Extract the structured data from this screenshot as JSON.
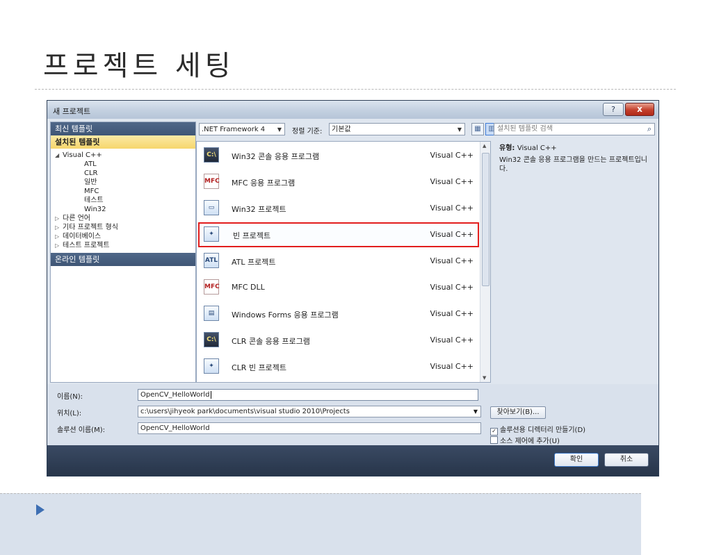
{
  "slide": {
    "title": "프로젝트 세팅"
  },
  "dialog": {
    "title": "새 프로젝트",
    "help_label": "?",
    "close_label": "x"
  },
  "left": {
    "recent_templates": "최신 템플릿",
    "installed_templates": "설치된 템플릿",
    "online_templates": "온라인 템플릿",
    "tree": [
      {
        "label": "Visual C++",
        "arrow": "◢"
      },
      {
        "label": "ATL"
      },
      {
        "label": "CLR"
      },
      {
        "label": "일반"
      },
      {
        "label": "MFC"
      },
      {
        "label": "테스트"
      },
      {
        "label": "Win32"
      },
      {
        "label": "다른 언어",
        "arrow": "▷"
      },
      {
        "label": "기타 프로젝트 형식",
        "arrow": "▷"
      },
      {
        "label": "데이터베이스",
        "arrow": "▷"
      },
      {
        "label": "테스트 프로젝트",
        "arrow": "▷"
      }
    ]
  },
  "toolbar": {
    "framework": ".NET Framework 4",
    "sort_label": "정렬 기준:",
    "sort_value": "기본값"
  },
  "templates": [
    {
      "name": "Win32 콘솔 응용 프로그램",
      "lang": "Visual C++",
      "icon": "console-app-icon",
      "glyph": "C:\\"
    },
    {
      "name": "MFC 응용 프로그램",
      "lang": "Visual C++",
      "icon": "mfc-app-icon",
      "glyph": "MFC"
    },
    {
      "name": "Win32 프로젝트",
      "lang": "Visual C++",
      "icon": "win32-project-icon",
      "glyph": "▭"
    },
    {
      "name": "빈 프로젝트",
      "lang": "Visual C++",
      "icon": "empty-project-icon",
      "glyph": "✦"
    },
    {
      "name": "ATL 프로젝트",
      "lang": "Visual C++",
      "icon": "atl-project-icon",
      "glyph": "ATL"
    },
    {
      "name": "MFC DLL",
      "lang": "Visual C++",
      "icon": "mfc-dll-icon",
      "glyph": "MFC"
    },
    {
      "name": "Windows Forms 응용 프로그램",
      "lang": "Visual C++",
      "icon": "windows-forms-icon",
      "glyph": "▤"
    },
    {
      "name": "CLR 콘솔 응용 프로그램",
      "lang": "Visual C++",
      "icon": "clr-console-icon",
      "glyph": "C:\\"
    },
    {
      "name": "CLR 빈 프로젝트",
      "lang": "Visual C++",
      "icon": "clr-empty-project-icon",
      "glyph": "✦"
    }
  ],
  "search": {
    "placeholder": "설치된 템플릿 검색"
  },
  "info": {
    "type_label": "유형:",
    "type_value": "Visual C++",
    "description": "Win32 콘솔 응용 프로그램을 만드는 프로젝트입니다."
  },
  "form": {
    "name_label": "이름(N):",
    "name_value": "OpenCV_HelloWorld",
    "location_label": "위치(L):",
    "location_value": "c:\\users\\jihyeok park\\documents\\visual studio 2010\\Projects",
    "solution_label": "솔루션 이름(M):",
    "solution_value": "OpenCV_HelloWorld",
    "browse_label": "찾아보기(B)...",
    "create_dir_label": "솔루션용 디렉터리 만들기(D)",
    "source_control_label": "소스 제어에 추가(U)"
  },
  "buttons": {
    "ok": "확인",
    "cancel": "취소"
  }
}
